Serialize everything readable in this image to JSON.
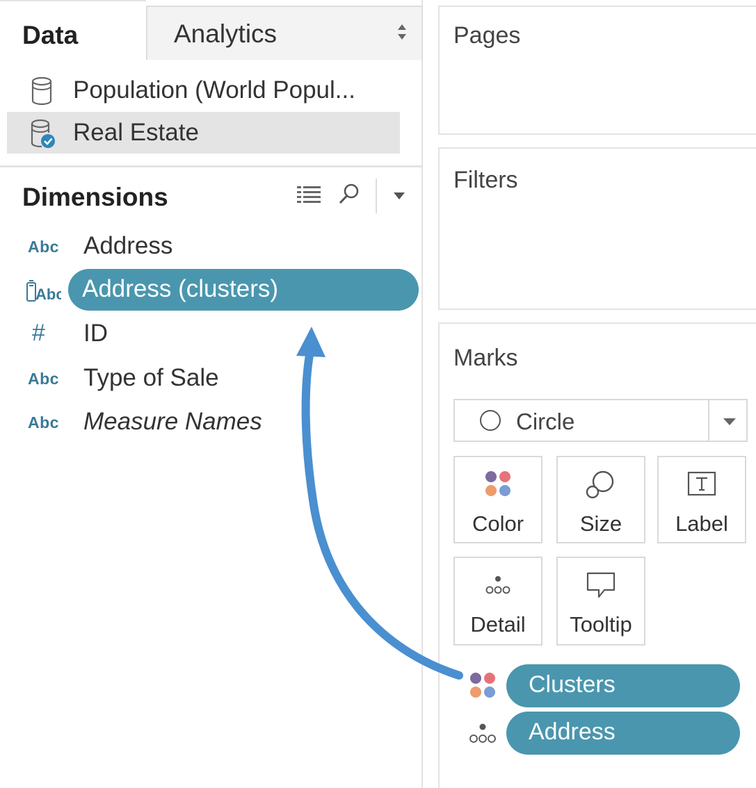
{
  "tabs": {
    "data": "Data",
    "analytics": "Analytics"
  },
  "data_sources": [
    {
      "label": "Population (World Popul...",
      "selected": false
    },
    {
      "label": "Real Estate",
      "selected": true
    }
  ],
  "dimensions": {
    "title": "Dimensions",
    "items": [
      {
        "type": "Abc",
        "label": "Address"
      },
      {
        "type": "cluster",
        "label": "Address (clusters)"
      },
      {
        "type": "#",
        "label": "ID"
      },
      {
        "type": "Abc",
        "label": "Type of Sale"
      },
      {
        "type": "Abc",
        "label": "Measure Names"
      }
    ]
  },
  "shelves": {
    "pages": "Pages",
    "filters": "Filters"
  },
  "marks": {
    "title": "Marks",
    "mark_type": "Circle",
    "buttons": {
      "color": "Color",
      "size": "Size",
      "label": "Label",
      "detail": "Detail",
      "tooltip": "Tooltip"
    },
    "fields": [
      {
        "encoding": "color",
        "label": "Clusters"
      },
      {
        "encoding": "detail",
        "label": "Address"
      }
    ]
  },
  "colors": {
    "pill": "#4a96ae",
    "arrow": "#4a8fd0",
    "type_icon": "#3a7a97",
    "dot_purple": "#7d6a9e",
    "dot_pink": "#e8727b",
    "dot_orange": "#ee9b6e",
    "dot_blue": "#7b9cd4"
  }
}
